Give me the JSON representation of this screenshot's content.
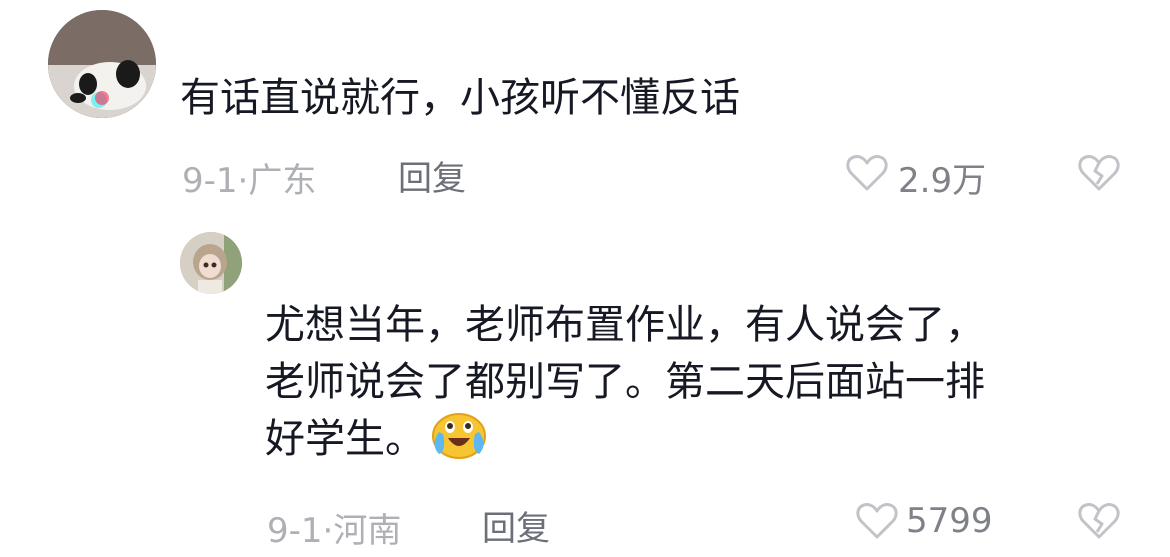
{
  "comments": [
    {
      "text": "有话直说就行，小孩听不懂反话",
      "date": "9-1",
      "location": "广东",
      "reply_label": "回复",
      "likes": "2.9万"
    }
  ],
  "replies": [
    {
      "text_lines": [
        "尤想当年，老师布置作业，有人说会了，",
        "老师说会了都别写了。第二天后面站一排",
        "好学生。"
      ],
      "emoji": "crying-laughing-emoji",
      "date": "9-1",
      "location": "河南",
      "reply_label": "回复",
      "likes": "5799"
    }
  ],
  "colors": {
    "text": "#161823",
    "meta": "#aeb0b6",
    "reply": "#6d6f78",
    "icon": "#c2c3c8"
  }
}
